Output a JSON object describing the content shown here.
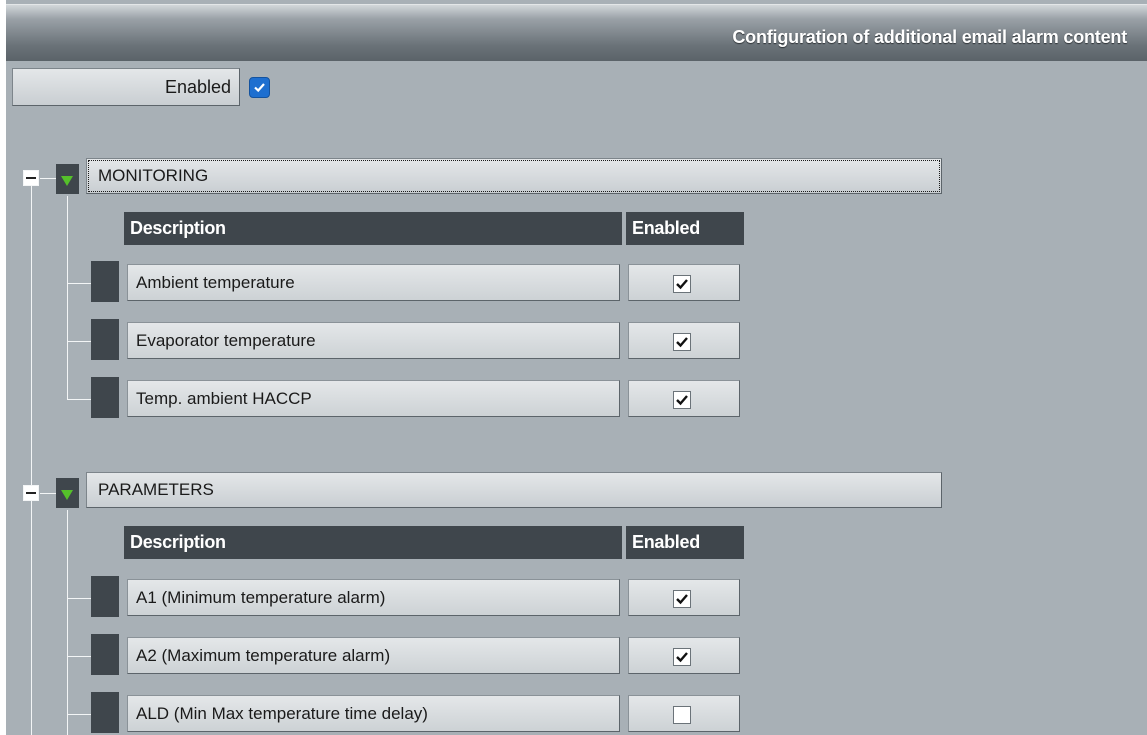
{
  "header": {
    "title": "Configuration of additional email alarm content"
  },
  "toggle": {
    "label": "Enabled",
    "checked": true
  },
  "columns": {
    "description": "Description",
    "enabled": "Enabled"
  },
  "groups": [
    {
      "name": "MONITORING",
      "expanded": true,
      "items": [
        {
          "label": "Ambient temperature",
          "checked": true
        },
        {
          "label": "Evaporator temperature",
          "checked": true
        },
        {
          "label": "Temp. ambient HACCP",
          "checked": true
        }
      ]
    },
    {
      "name": "PARAMETERS",
      "expanded": true,
      "items": [
        {
          "label": "A1 (Minimum temperature alarm)",
          "checked": true
        },
        {
          "label": "A2 (Maximum temperature alarm)",
          "checked": true
        },
        {
          "label": "ALD (Min Max temperature time delay)",
          "checked": false
        }
      ]
    }
  ],
  "colors": {
    "accent_check": "#1e6fd0",
    "expand_arrow": "#55c02a",
    "dark_header": "#3f464c"
  }
}
